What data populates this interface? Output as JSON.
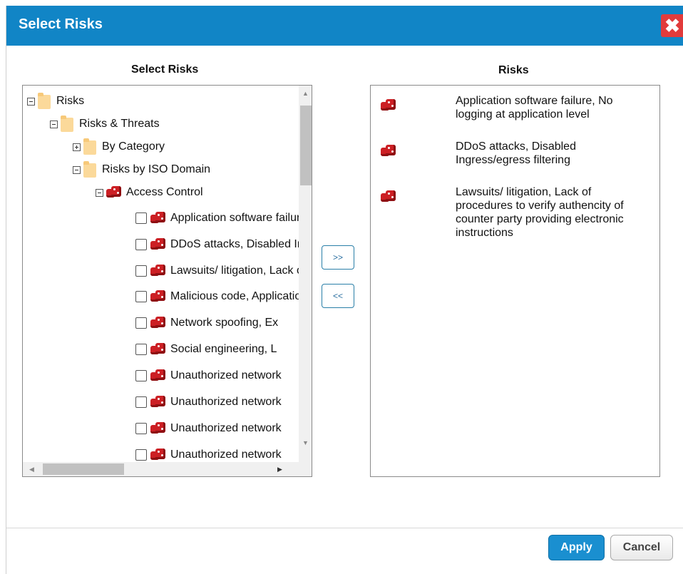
{
  "dialog": {
    "title": "Select Risks",
    "close_icon": "close-icon"
  },
  "left_column_title": "Select Risks",
  "right_column_title": "Risks",
  "tree": {
    "root": "Risks",
    "risks_threats": "Risks & Threats",
    "by_category": "By Category",
    "by_iso_domain": "Risks by ISO Domain",
    "access_control": "Access Control",
    "items": [
      "Application software failure, No logging at application level",
      "DDoS attacks, Disabled Ingress/egress filtering",
      "Lawsuits/ litigation, Lack of procedures to verify authencity of counter party providing electronic instructions",
      "Malicious code, Application",
      "Network spoofing, Ex",
      "Social engineering, L",
      "Unauthorized network",
      "Unauthorized network",
      "Unauthorized network",
      "Unauthorized network"
    ]
  },
  "transfer": {
    "add_label": ">>",
    "remove_label": "<<"
  },
  "selected_risks": [
    "Application software failure, No logging at application level",
    "DDoS attacks, Disabled Ingress/egress filtering",
    "Lawsuits/ litigation, Lack of procedures to verify authencity of counter party providing electronic instructions"
  ],
  "footer": {
    "apply_label": "Apply",
    "cancel_label": "Cancel"
  },
  "colors": {
    "titlebar": "#1185c6",
    "close": "#e23b3b",
    "apply": "#1a8fd0",
    "risk_icon": "#cc1f24"
  }
}
